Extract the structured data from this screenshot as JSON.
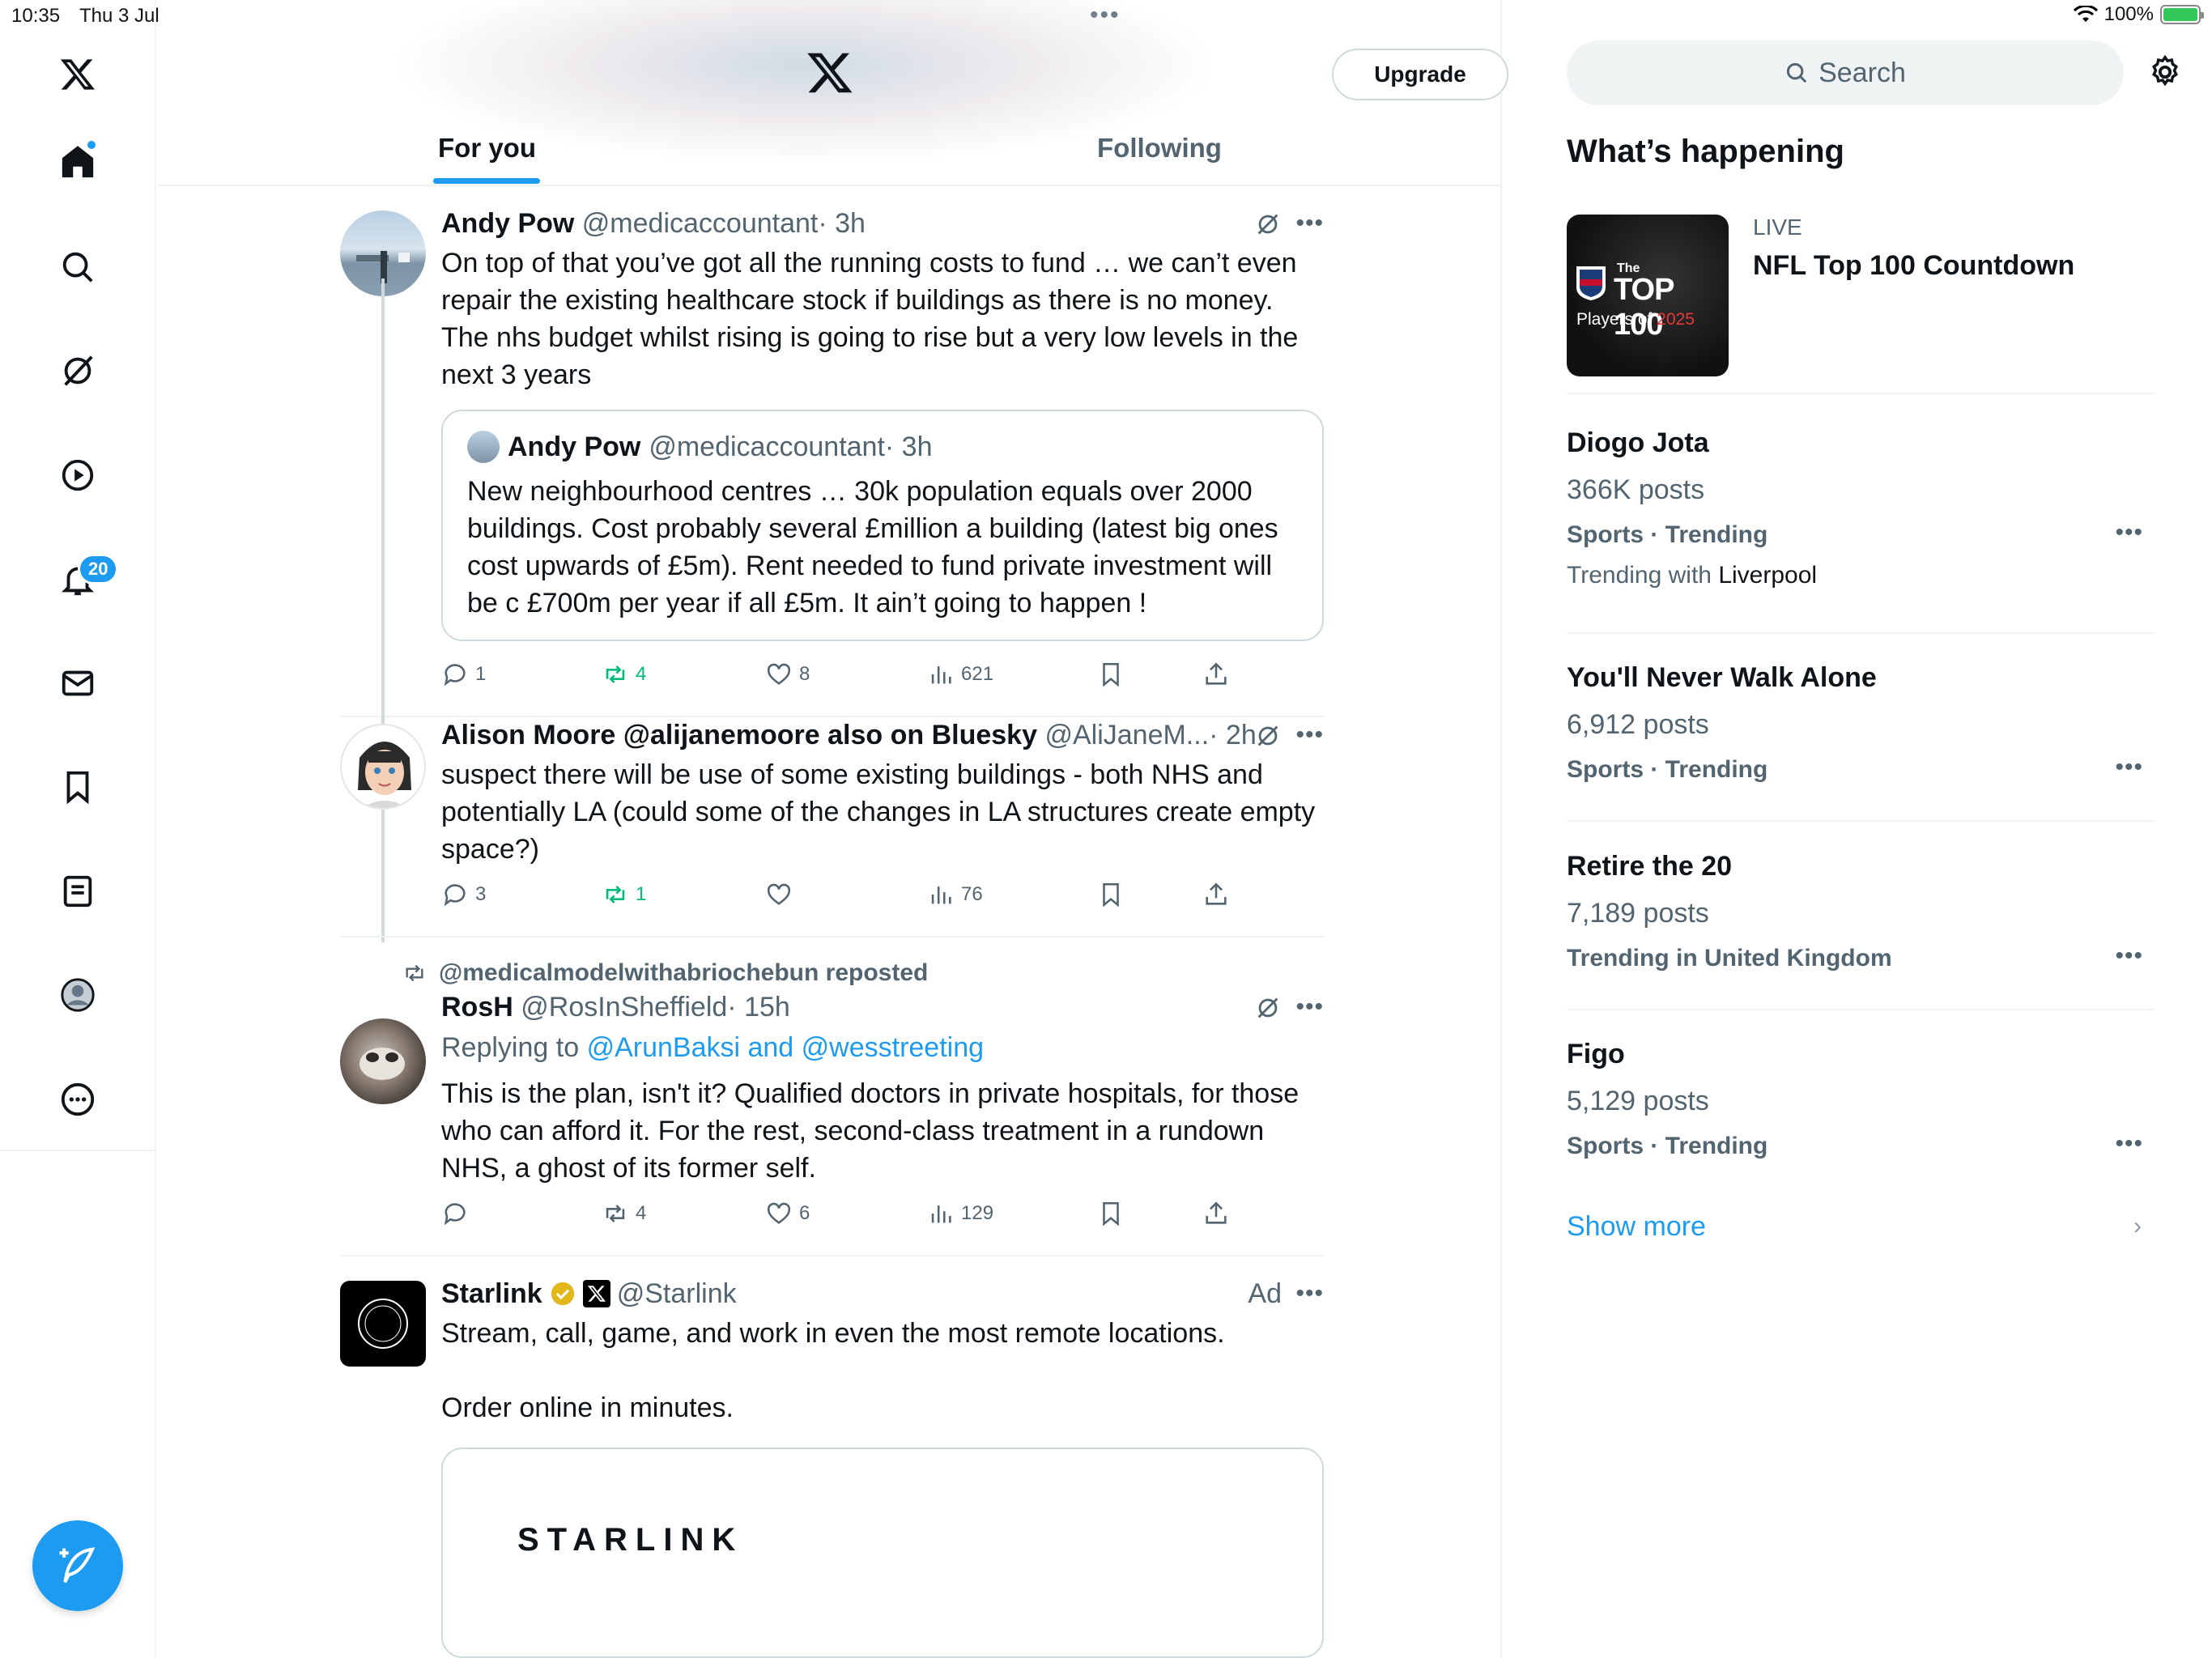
{
  "status_bar": {
    "time": "10:35",
    "date": "Thu 3 Jul",
    "battery": "100%"
  },
  "nav": {
    "notifications_badge": "20"
  },
  "header": {
    "upgrade_label": "Upgrade"
  },
  "tabs": [
    {
      "label": "For you"
    },
    {
      "label": "Following"
    }
  ],
  "posts": [
    {
      "name": "Andy Pow",
      "handle": "@medicaccountant",
      "time": "· 3h",
      "text": "On top of that you’ve got all the running costs to fund … we can’t even repair the existing healthcare stock if buildings as there is no money. The nhs budget whilst rising is going to rise but a very low levels in the next 3 years",
      "quote": {
        "name": "Andy Pow",
        "handle": "@medicaccountant",
        "time": "· 3h",
        "text": "New neighbourhood centres … 30k population equals over 2000 buildings. Cost probably several £million a building (latest big ones cost upwards of £5m). Rent needed to fund private investment will be c £700m per year if all £5m. It ain’t going to happen !"
      },
      "replies": "1",
      "reposts": "4",
      "likes": "8",
      "views": "621"
    },
    {
      "name": "Alison Moore @alijanemoore also on Bluesky",
      "handle": "@AliJaneM...",
      "time": "· 2h",
      "text": "suspect there will be use of some existing buildings - both NHS and potentially LA (could some of the changes in LA structures create empty space?)",
      "replies": "3",
      "reposts": "1",
      "likes": "",
      "views": "76"
    },
    {
      "repost_label": "@medicalmodelwithabriochebun reposted",
      "name": "RosH",
      "handle": "@RosInSheffield",
      "time": "· 15h",
      "replying_prefix": "Replying to",
      "replying_to": "@ArunBaksi and @wesstreeting",
      "text": "This is the plan, isn't it? Qualified doctors in private hospitals, for those who can afford it. For the rest, second-class treatment in a rundown NHS, a ghost of its former self.",
      "replies": "",
      "reposts": "4",
      "likes": "6",
      "views": "129"
    },
    {
      "name": "Starlink",
      "handle": "@Starlink",
      "ad_label": "Ad",
      "text1": "Stream, call, game, and work in even the most remote locations.",
      "text2": "Order online in minutes.",
      "card_brand": "STARLINK"
    }
  ],
  "sidebar": {
    "search_placeholder": "Search",
    "title": "What’s happening",
    "live": {
      "label": "LIVE",
      "title": "NFL Top 100 Countdown",
      "thumb_the": "The",
      "thumb_top": "TOP 100",
      "thumb_players": "Players of",
      "thumb_year": "2025"
    },
    "trends": [
      {
        "name": "Diogo Jota",
        "posts": "366K posts",
        "category": "Sports · Trending",
        "with_prefix": "Trending with",
        "with": "Liverpool"
      },
      {
        "name": "You'll Never Walk Alone",
        "posts": "6,912 posts",
        "category": "Sports · Trending"
      },
      {
        "name": "Retire the 20",
        "posts": "7,189 posts",
        "category": "Trending in United Kingdom"
      },
      {
        "name": "Figo",
        "posts": "5,129 posts",
        "category": "Sports · Trending"
      }
    ],
    "show_more": "Show more"
  },
  "colors": {
    "accent": "#1d9bf0",
    "repost_green": "#00ba7c",
    "muted": "#536471"
  }
}
